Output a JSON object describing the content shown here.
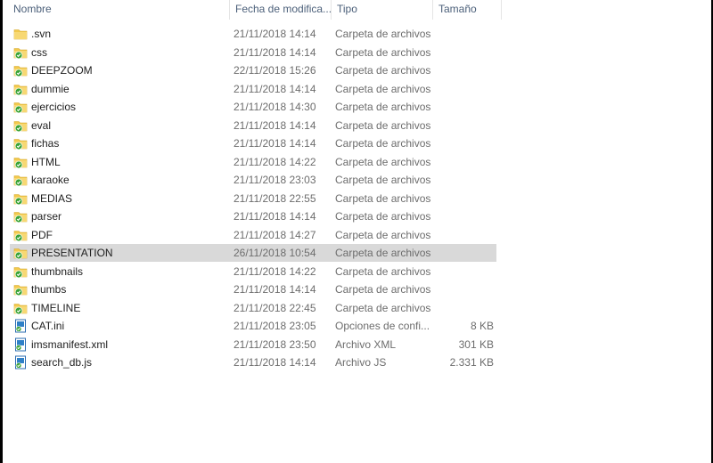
{
  "columns": {
    "name": "Nombre",
    "date": "Fecha de modifica...",
    "type": "Tipo",
    "size": "Tamaño"
  },
  "files": [
    {
      "name": ".svn",
      "date": "21/11/2018 14:14",
      "type": "Carpeta de archivos",
      "size": "",
      "icon": "folder-icon",
      "selected": false
    },
    {
      "name": "css",
      "date": "21/11/2018 14:14",
      "type": "Carpeta de archivos",
      "size": "",
      "icon": "folder-synced-icon",
      "selected": false
    },
    {
      "name": "DEEPZOOM",
      "date": "22/11/2018 15:26",
      "type": "Carpeta de archivos",
      "size": "",
      "icon": "folder-synced-icon",
      "selected": false
    },
    {
      "name": "dummie",
      "date": "21/11/2018 14:14",
      "type": "Carpeta de archivos",
      "size": "",
      "icon": "folder-synced-icon",
      "selected": false
    },
    {
      "name": "ejercicios",
      "date": "21/11/2018 14:30",
      "type": "Carpeta de archivos",
      "size": "",
      "icon": "folder-synced-icon",
      "selected": false
    },
    {
      "name": "eval",
      "date": "21/11/2018 14:14",
      "type": "Carpeta de archivos",
      "size": "",
      "icon": "folder-synced-icon",
      "selected": false
    },
    {
      "name": "fichas",
      "date": "21/11/2018 14:14",
      "type": "Carpeta de archivos",
      "size": "",
      "icon": "folder-synced-icon",
      "selected": false
    },
    {
      "name": "HTML",
      "date": "21/11/2018 14:22",
      "type": "Carpeta de archivos",
      "size": "",
      "icon": "folder-synced-icon",
      "selected": false
    },
    {
      "name": "karaoke",
      "date": "21/11/2018 23:03",
      "type": "Carpeta de archivos",
      "size": "",
      "icon": "folder-synced-icon",
      "selected": false
    },
    {
      "name": "MEDIAS",
      "date": "21/11/2018 22:55",
      "type": "Carpeta de archivos",
      "size": "",
      "icon": "folder-synced-icon",
      "selected": false
    },
    {
      "name": "parser",
      "date": "21/11/2018 14:14",
      "type": "Carpeta de archivos",
      "size": "",
      "icon": "folder-synced-icon",
      "selected": false
    },
    {
      "name": "PDF",
      "date": "21/11/2018 14:27",
      "type": "Carpeta de archivos",
      "size": "",
      "icon": "folder-synced-icon",
      "selected": false
    },
    {
      "name": "PRESENTATION",
      "date": "26/11/2018 10:54",
      "type": "Carpeta de archivos",
      "size": "",
      "icon": "folder-synced-icon",
      "selected": true
    },
    {
      "name": "thumbnails",
      "date": "21/11/2018 14:22",
      "type": "Carpeta de archivos",
      "size": "",
      "icon": "folder-synced-icon",
      "selected": false
    },
    {
      "name": "thumbs",
      "date": "21/11/2018 14:14",
      "type": "Carpeta de archivos",
      "size": "",
      "icon": "folder-synced-icon",
      "selected": false
    },
    {
      "name": "TIMELINE",
      "date": "21/11/2018 22:45",
      "type": "Carpeta de archivos",
      "size": "",
      "icon": "folder-synced-icon",
      "selected": false
    },
    {
      "name": "CAT.ini",
      "date": "21/11/2018 23:05",
      "type": "Opciones de confi...",
      "size": "8 KB",
      "icon": "file-synced-icon",
      "selected": false
    },
    {
      "name": "imsmanifest.xml",
      "date": "21/11/2018 23:50",
      "type": "Archivo XML",
      "size": "301 KB",
      "icon": "file-synced-icon",
      "selected": false
    },
    {
      "name": "search_db.js",
      "date": "21/11/2018 14:14",
      "type": "Archivo JS",
      "size": "2.331 KB",
      "icon": "file-synced-icon",
      "selected": false
    }
  ],
  "colors": {
    "folder": "#f2c94c",
    "sync": "#3aa335",
    "selected": "#d9d9d9",
    "header_text": "#4c607a"
  }
}
